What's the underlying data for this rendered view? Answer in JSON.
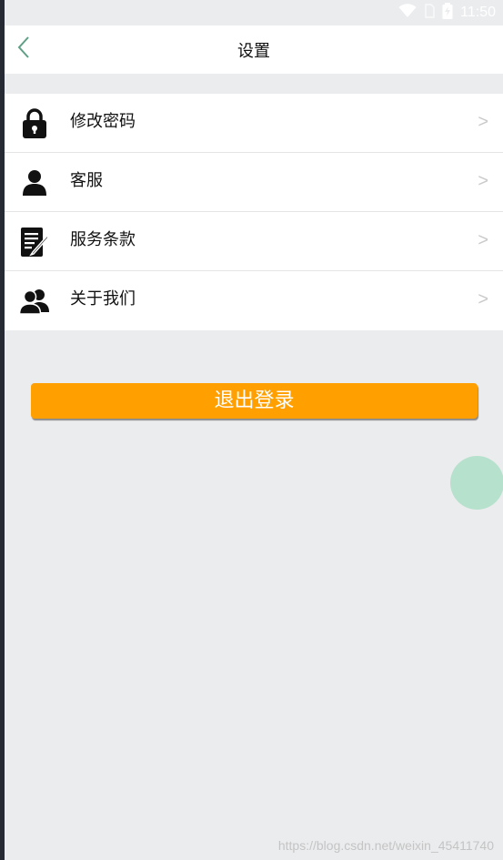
{
  "status_bar": {
    "time": "11:50"
  },
  "header": {
    "title": "设置"
  },
  "menu": {
    "items": [
      {
        "label": "修改密码",
        "icon": "lock-icon",
        "arrow": ">"
      },
      {
        "label": "客服",
        "icon": "person-icon",
        "arrow": ">"
      },
      {
        "label": "服务条款",
        "icon": "document-edit-icon",
        "arrow": ">"
      },
      {
        "label": "关于我们",
        "icon": "group-icon",
        "arrow": ">"
      }
    ]
  },
  "logout": {
    "label": "退出登录",
    "color": "#ff9f00"
  },
  "watermark": "https://blog.csdn.net/weixin_45411740",
  "colors": {
    "background": "#ebecee",
    "accent_circle": "#b6e1cc",
    "back_arrow": "#5f9f86"
  }
}
